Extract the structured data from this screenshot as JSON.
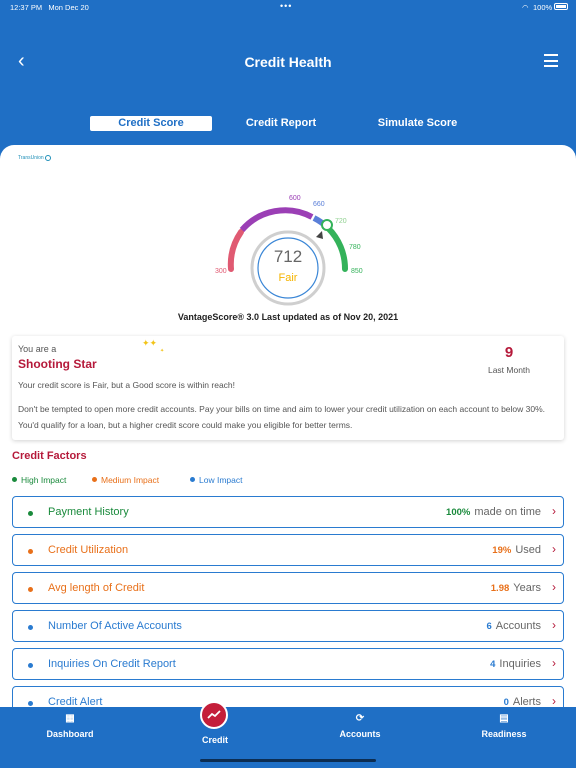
{
  "status": {
    "time": "12:37 PM",
    "date": "Mon Dec 20",
    "battery": "100%",
    "battery_level": 1.0
  },
  "header": {
    "title": "Credit Health",
    "back_icon": "chevron-left-icon",
    "menu_icon": "hamburger-menu-icon"
  },
  "tabs": [
    {
      "label": "Credit Score",
      "active": true
    },
    {
      "label": "Credit Report",
      "active": false
    },
    {
      "label": "Simulate Score",
      "active": false
    }
  ],
  "bureau_logo": "TransUnion",
  "gauge": {
    "score": "712",
    "rating": "Fair",
    "ticks": [
      "300",
      "600",
      "660",
      "720",
      "780",
      "850"
    ],
    "min": 300,
    "max": 850,
    "score_value": 712,
    "colors": {
      "red": "#e05a72",
      "purple": "#9b3fb5",
      "blue": "#5a7fd8",
      "green": "#34b25a",
      "rating": "#f5b400"
    }
  },
  "vantage_text": "VantageScore® 3.0 Last updated as of Nov 20, 2021",
  "summary_card": {
    "prefix": "You are a",
    "badge": "Shooting Star",
    "change_value": "9",
    "change_label": "Last Month",
    "message1": "Your credit score is Fair, but a Good score is within reach!",
    "message2": "Don't be tempted to open more credit accounts. Pay your bills on time and aim to lower your credit utilization on each account to below 30%. You'd qualify for a loan, but a higher credit score could make you eligible for better terms."
  },
  "credit_factors": {
    "title": "Credit Factors",
    "legend": [
      {
        "label": "High Impact",
        "color": "#1a8a3c"
      },
      {
        "label": "Medium Impact",
        "color": "#e8701a"
      },
      {
        "label": "Low Impact",
        "color": "#2a7bd0"
      }
    ],
    "items": [
      {
        "label": "Payment History",
        "value": "100%",
        "unit": "made on time",
        "color": "#1a8a3c"
      },
      {
        "label": "Credit Utilization",
        "value": "19%",
        "unit": "Used",
        "color": "#e8701a"
      },
      {
        "label": "Avg length of Credit",
        "value": "1.98",
        "unit": "Years",
        "color": "#e8701a"
      },
      {
        "label": "Number Of Active Accounts",
        "value": "6",
        "unit": "Accounts",
        "color": "#2a7bd0"
      },
      {
        "label": "Inquiries On Credit Report",
        "value": "4",
        "unit": "Inquiries",
        "color": "#2a7bd0"
      },
      {
        "label": "Credit Alert",
        "value": "0",
        "unit": "Alerts",
        "color": "#2a7bd0"
      }
    ]
  },
  "bottom_nav": [
    {
      "label": "Dashboard",
      "icon": "grid-icon"
    },
    {
      "label": "Credit",
      "icon": "trend-up-icon",
      "active": true
    },
    {
      "label": "Accounts",
      "icon": "dollar-sync-icon"
    },
    {
      "label": "Readiness",
      "icon": "document-icon"
    }
  ]
}
